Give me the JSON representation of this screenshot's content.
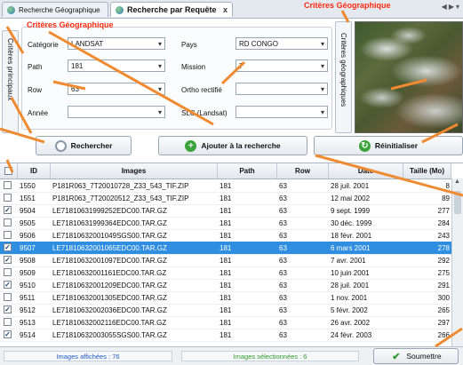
{
  "tabs": [
    {
      "label": "Recherche Géographique"
    },
    {
      "label": "Recherche par Requête",
      "close": "x"
    }
  ],
  "nav_arrows": [
    "◀",
    "▶",
    "▾"
  ],
  "side_tabs": {
    "left": "Critères principaux",
    "right": "Critères géographiques"
  },
  "annotations": {
    "top_right": "Critères Géographique",
    "top_left": "Critères Géographique"
  },
  "form": {
    "categorie": {
      "label": "Catégorie",
      "value": "LANDSAT"
    },
    "path": {
      "label": "Path",
      "value": "181"
    },
    "row": {
      "label": "Row",
      "value": "63"
    },
    "annee": {
      "label": "Année",
      "value": ""
    },
    "pays": {
      "label": "Pays",
      "value": "RD CONGO"
    },
    "mission": {
      "label": "Mission",
      "value": "7"
    },
    "ortho": {
      "label": "Ortho rectifié",
      "value": ""
    },
    "slc": {
      "label": "SLC (Landsat)",
      "value": ""
    }
  },
  "buttons": {
    "rechercher": "Rechercher",
    "ajouter": "Ajouter à la recherche",
    "reinitialiser": "Réinitialiser",
    "soumettre": "Soumettre"
  },
  "table": {
    "columns": [
      "ID",
      "Images",
      "Path",
      "Row",
      "Date",
      "Taille (Mo)"
    ],
    "rows": [
      {
        "checked": false,
        "id": "1550",
        "image": "P181R063_7T20010728_Z33_543_TIF.ZIP",
        "path": "181",
        "row": "63",
        "date": "28 juil. 2001",
        "size": "8"
      },
      {
        "checked": false,
        "id": "1551",
        "image": "P181R063_7T20020512_Z33_543_TIF.ZIP",
        "path": "181",
        "row": "63",
        "date": "12 mai 2002",
        "size": "89"
      },
      {
        "checked": true,
        "id": "9504",
        "image": "LE71810631999252EDC00.TAR.GZ",
        "path": "181",
        "row": "63",
        "date": "9 sept. 1999",
        "size": "277"
      },
      {
        "checked": false,
        "id": "9505",
        "image": "LE71810631999364EDC00.TAR.GZ",
        "path": "181",
        "row": "63",
        "date": "30 déc. 1999",
        "size": "284"
      },
      {
        "checked": false,
        "id": "9506",
        "image": "LE71810632001049SGS00.TAR.GZ",
        "path": "181",
        "row": "63",
        "date": "18 févr. 2001",
        "size": "243"
      },
      {
        "checked": true,
        "id": "9507",
        "image": "LE71810632001065EDC00.TAR.GZ",
        "path": "181",
        "row": "63",
        "date": "6 mars 2001",
        "size": "278",
        "selected": true
      },
      {
        "checked": true,
        "id": "9508",
        "image": "LE71810632001097EDC00.TAR.GZ",
        "path": "181",
        "row": "63",
        "date": "7 avr. 2001",
        "size": "292"
      },
      {
        "checked": false,
        "id": "9509",
        "image": "LE71810632001161EDC00.TAR.GZ",
        "path": "181",
        "row": "63",
        "date": "10 juin 2001",
        "size": "275"
      },
      {
        "checked": true,
        "id": "9510",
        "image": "LE71810632001209EDC00.TAR.GZ",
        "path": "181",
        "row": "63",
        "date": "28 juil. 2001",
        "size": "291"
      },
      {
        "checked": false,
        "id": "9511",
        "image": "LE71810632001305EDC00.TAR.GZ",
        "path": "181",
        "row": "63",
        "date": "1 nov. 2001",
        "size": "300"
      },
      {
        "checked": true,
        "id": "9512",
        "image": "LE71810632002036EDC00.TAR.GZ",
        "path": "181",
        "row": "63",
        "date": "5 févr. 2002",
        "size": "265"
      },
      {
        "checked": false,
        "id": "9513",
        "image": "LE71810632002116EDC00.TAR.GZ",
        "path": "181",
        "row": "63",
        "date": "26 avr. 2002",
        "size": "297"
      },
      {
        "checked": true,
        "id": "9514",
        "image": "LE71810632003055SGS00.TAR.GZ",
        "path": "181",
        "row": "63",
        "date": "24 févr. 2003",
        "size": "266"
      }
    ]
  },
  "status": {
    "affichees": "Images affichées : 76",
    "selectionnees": "Images sélectionnées : 6"
  },
  "colors": {
    "annotation": "#ff2a10",
    "selection": "#2f8ee0",
    "status_text": "#1f58c7",
    "status_green": "#2e9a2e"
  }
}
